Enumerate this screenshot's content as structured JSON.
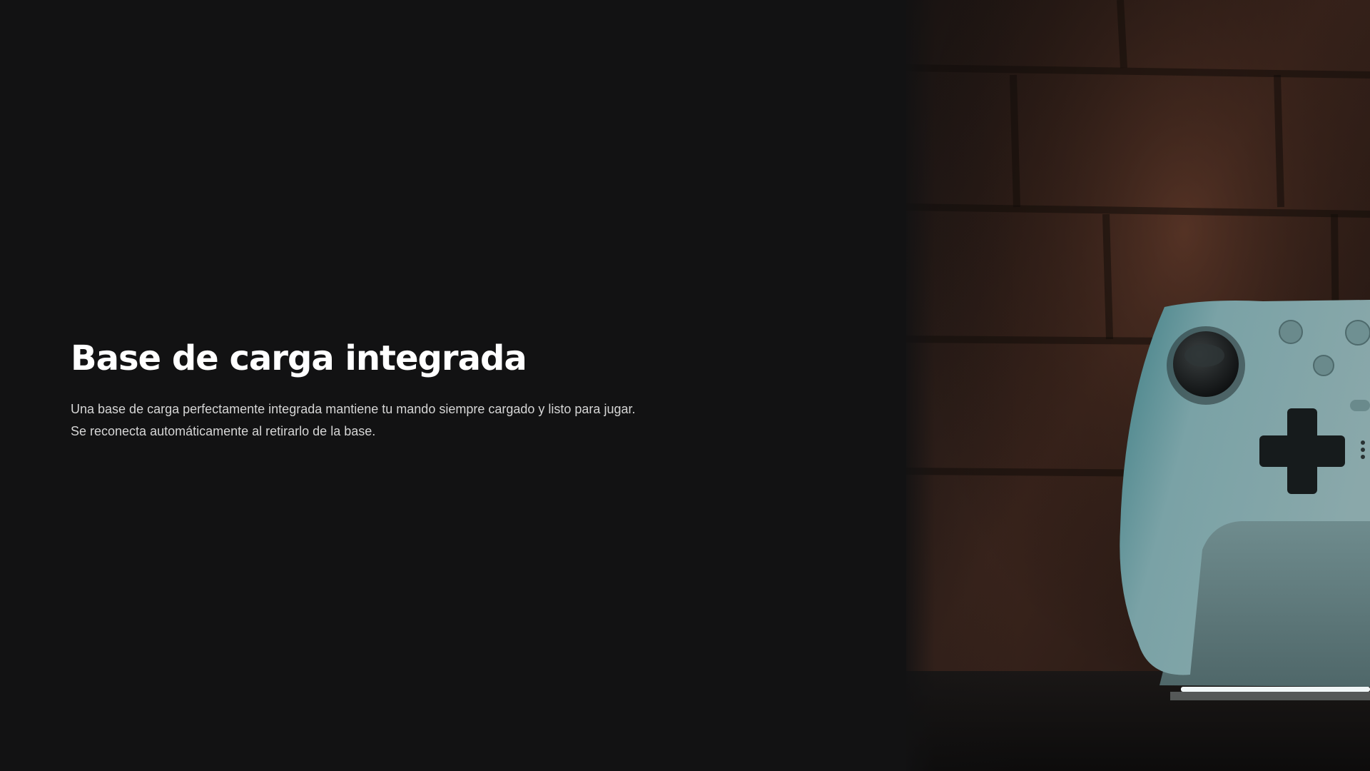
{
  "section": {
    "title": "Base de carga integrada",
    "description_lines": [
      "Una base de carga perfectamente integrada mantiene tu mando siempre cargado y listo para jugar.",
      "Se reconecta automáticamente al retirarlo de la base."
    ]
  },
  "media": {
    "image_subject": "controller-on-charging-dock",
    "colors": {
      "page_background": "#121213",
      "controller_body": "#7fa3a6",
      "brick_wall": "#3a241c"
    }
  }
}
